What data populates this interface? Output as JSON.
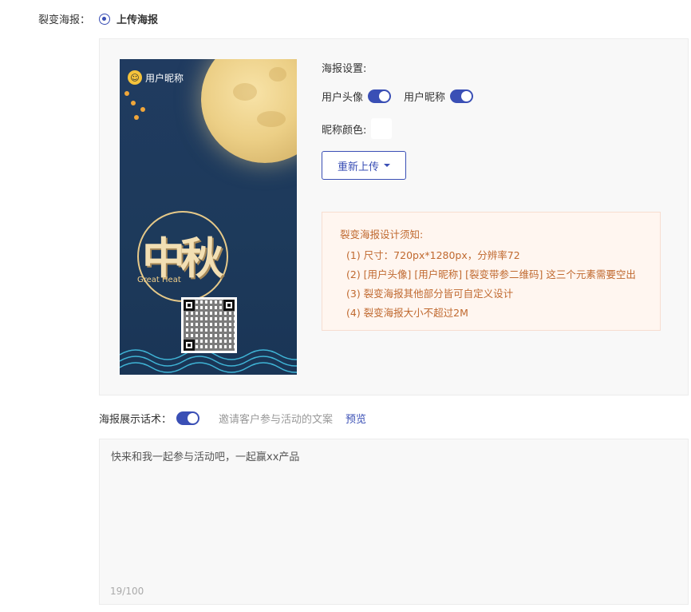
{
  "fission_poster": {
    "label": "裂变海报：",
    "option_label": "上传海报"
  },
  "poster_preview": {
    "nickname_text": "用户昵称",
    "calligraphy": "中秋",
    "english": "Great Heat"
  },
  "poster_settings": {
    "title": "海报设置:",
    "avatar_label": "用户头像",
    "avatar_enabled": true,
    "nickname_label": "用户昵称",
    "nickname_enabled": true,
    "nickname_color_label": "昵称颜色:",
    "nickname_color": "#ffffff",
    "reupload_label": "重新上传"
  },
  "notice": {
    "title": "裂变海报设计须知:",
    "items": [
      "(1) 尺寸：720px*1280px，分辨率72",
      "(2) [用户头像] [用户昵称] [裂变带参二维码] 这三个元素需要空出",
      "(3) 裂变海报其他部分皆可自定义设计",
      "(4) 裂变海报大小不超过2M"
    ]
  },
  "display_copy": {
    "label": "海报展示话术：",
    "enabled": true,
    "description": "邀请客户参与活动的文案",
    "preview_label": "预览",
    "text": "快来和我一起参与活动吧，一起赢xx产品",
    "counter": "19/100"
  },
  "colors": {
    "accent": "#3a4fb5",
    "notice_text": "#c0692f",
    "notice_bg": "#fff6f0"
  }
}
